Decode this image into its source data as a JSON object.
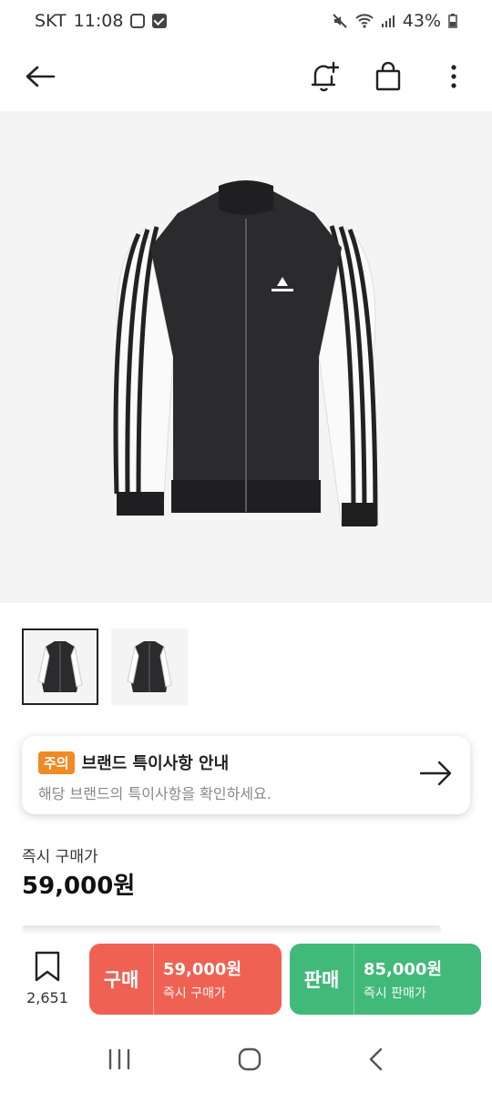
{
  "status": {
    "carrier": "SKT",
    "time": "11:08",
    "battery": "43%",
    "left_icons": [
      "instagram-icon",
      "check-box-icon"
    ],
    "right_icons": [
      "mute-icon",
      "wifi-icon",
      "signal-icon",
      "battery-icon"
    ]
  },
  "toolbar": {
    "icons": [
      "back-arrow-icon",
      "bell-plus-icon",
      "shopping-bag-icon",
      "more-vert-icon"
    ]
  },
  "product": {
    "image_name": "track-jacket",
    "thumbnail_count": 2
  },
  "notice": {
    "badge": "주의",
    "title": "브랜드 특이사항 안내",
    "subtitle": "해당 브랜드의 특이사항을 확인하세요."
  },
  "price": {
    "label": "즉시 구매가",
    "value": "59,000원"
  },
  "bottom": {
    "bookmark_count": "2,651",
    "buy": {
      "label": "구매",
      "price": "59,000원",
      "sub": "즉시 구매가",
      "color": "#ef6253"
    },
    "sell": {
      "label": "판매",
      "price": "85,000원",
      "sub": "즉시 판매가",
      "color": "#41b979"
    }
  },
  "nav": {
    "icons": [
      "recent-apps-icon",
      "home-icon",
      "back-icon"
    ]
  }
}
